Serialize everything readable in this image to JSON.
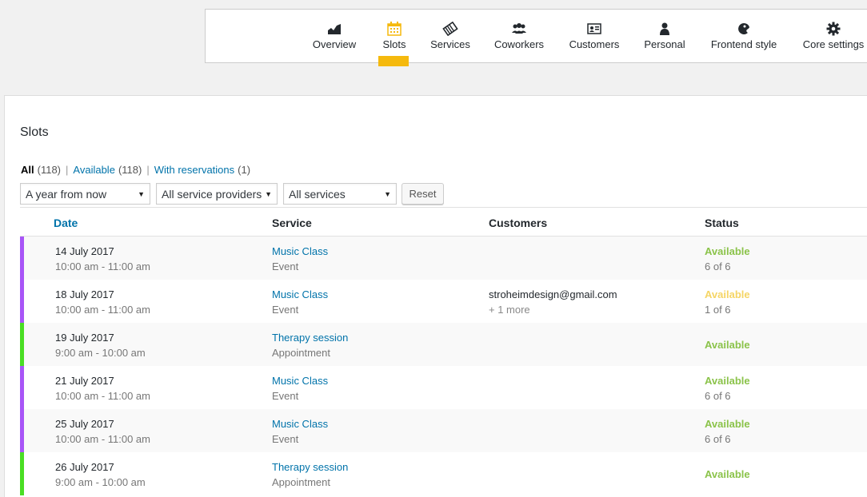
{
  "nav": {
    "items": [
      {
        "label": "Overview",
        "icon": "chart-icon"
      },
      {
        "label": "Slots",
        "icon": "calendar-icon"
      },
      {
        "label": "Services",
        "icon": "services-icon"
      },
      {
        "label": "Coworkers",
        "icon": "coworkers-icon"
      },
      {
        "label": "Customers",
        "icon": "customers-icon"
      },
      {
        "label": "Personal",
        "icon": "person-icon"
      },
      {
        "label": "Frontend style",
        "icon": "palette-icon"
      },
      {
        "label": "Core settings",
        "icon": "gear-icon"
      }
    ],
    "active": "Slots",
    "active_color": "#f5b90d"
  },
  "page": {
    "title": "Slots"
  },
  "views": {
    "all_label": "All",
    "all_count": "(118)",
    "available_label": "Available",
    "available_count": "(118)",
    "with_res_label": "With reservations",
    "with_res_count": "(1)",
    "separator": "|"
  },
  "filters": {
    "period": "A year from now",
    "providers": "All service providers",
    "services": "All services",
    "reset_label": "Reset"
  },
  "table": {
    "columns": {
      "date": "Date",
      "service": "Service",
      "customers": "Customers",
      "status": "Status"
    },
    "rows": [
      {
        "date": "14 July 2017",
        "time": "10:00 am - 11:00 am",
        "service": "Music Class",
        "type": "Event",
        "customer": "",
        "customer_more": "",
        "status": "Available",
        "capacity": "6 of 6",
        "stripe": "#a855f7"
      },
      {
        "date": "18 July 2017",
        "time": "10:00 am - 11:00 am",
        "service": "Music Class",
        "type": "Event",
        "customer": "stroheimdesign@gmail.com",
        "customer_more": "+ 1 more",
        "status": "Available",
        "capacity": "1 of 6",
        "stripe": "#a855f7"
      },
      {
        "date": "19 July 2017",
        "time": "9:00 am - 10:00 am",
        "service": "Therapy session",
        "type": "Appointment",
        "customer": "",
        "customer_more": "",
        "status": "Available",
        "capacity": "",
        "stripe": "#4ade24"
      },
      {
        "date": "21 July 2017",
        "time": "10:00 am - 11:00 am",
        "service": "Music Class",
        "type": "Event",
        "customer": "",
        "customer_more": "",
        "status": "Available",
        "capacity": "6 of 6",
        "stripe": "#a855f7"
      },
      {
        "date": "25 July 2017",
        "time": "10:00 am - 11:00 am",
        "service": "Music Class",
        "type": "Event",
        "customer": "",
        "customer_more": "",
        "status": "Available",
        "capacity": "6 of 6",
        "stripe": "#a855f7"
      },
      {
        "date": "26 July 2017",
        "time": "9:00 am - 10:00 am",
        "service": "Therapy session",
        "type": "Appointment",
        "customer": "",
        "customer_more": "",
        "status": "Available",
        "capacity": "",
        "stripe": "#4ade24"
      }
    ]
  }
}
